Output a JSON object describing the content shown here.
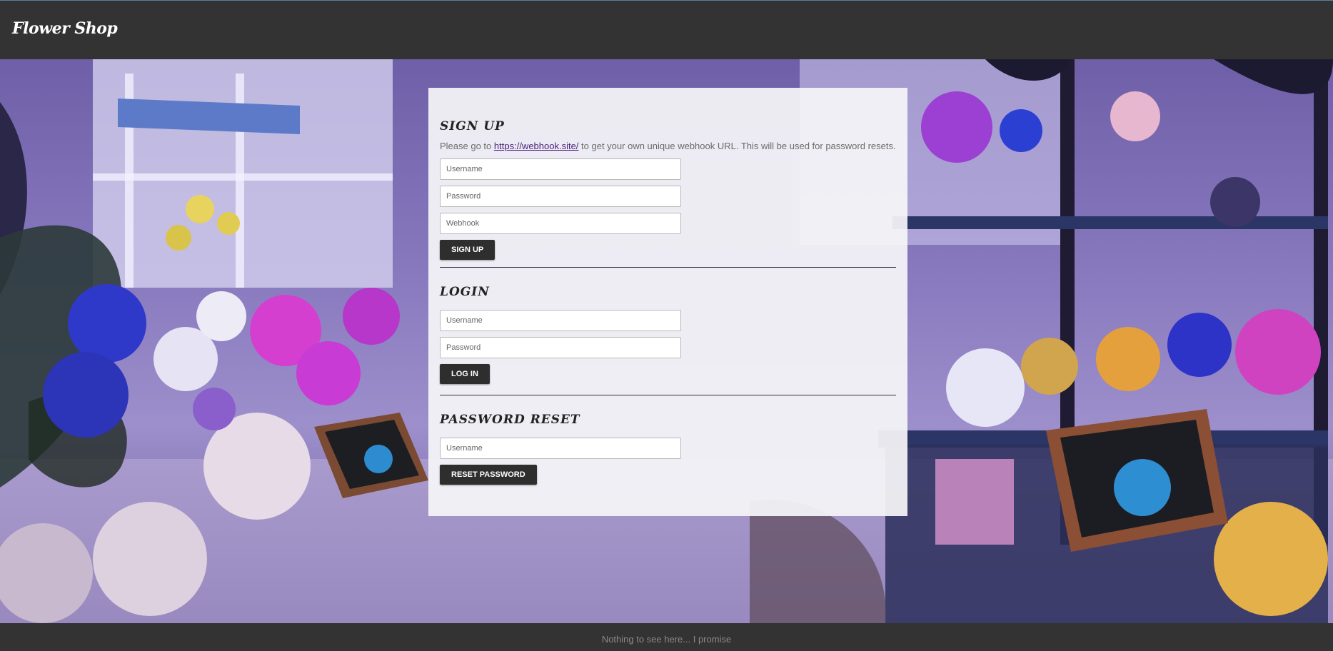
{
  "header": {
    "brand": "Flower Shop"
  },
  "signup": {
    "title": "SIGN UP",
    "help_prefix": "Please go to",
    "help_link": "https://webhook.site/",
    "help_suffix": "to get your own unique webhook URL. This will be used for password resets.",
    "username_placeholder": "Username",
    "password_placeholder": "Password",
    "webhook_placeholder": "Webhook",
    "button_label": "SIGN UP"
  },
  "login": {
    "title": "LOGIN",
    "username_placeholder": "Username",
    "password_placeholder": "Password",
    "button_label": "LOG IN"
  },
  "reset": {
    "title": "PASSWORD RESET",
    "username_placeholder": "Username",
    "button_label": "RESET PASSWORD"
  },
  "footer": {
    "text": "Nothing to see here... I promise"
  },
  "colors": {
    "bar_background": "#333333",
    "button_background": "#2e2e2e",
    "link": "#4b1e7a",
    "card_background": "#f5f5f8"
  }
}
